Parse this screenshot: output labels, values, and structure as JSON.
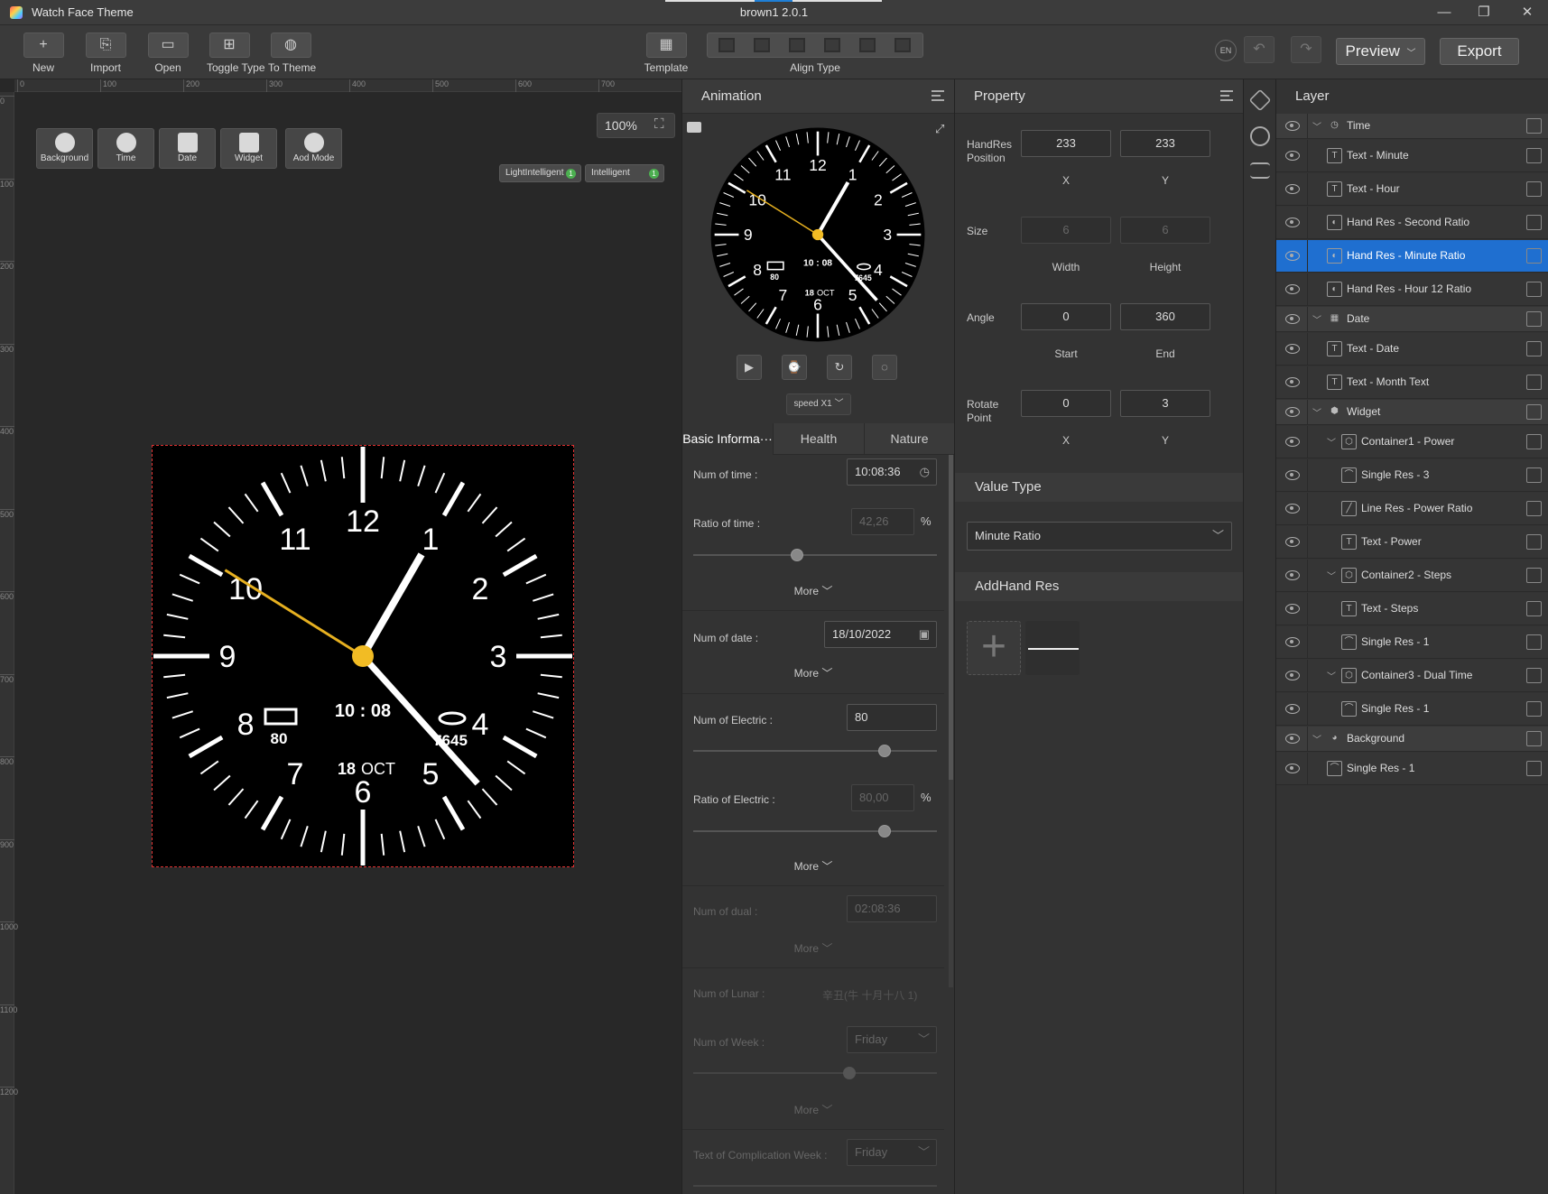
{
  "window": {
    "app_title": "Watch Face Theme",
    "doc_title": "brown1 2.0.1",
    "min": "—",
    "restore": "❐",
    "close": "✕"
  },
  "toolbar": {
    "new": "New",
    "import": "Import",
    "open": "Open",
    "toggle_type": "Toggle Type",
    "to_theme": "To Theme",
    "template": "Template",
    "align_type": "Align Type",
    "lang": "EN",
    "preview": "Preview",
    "export": "Export"
  },
  "canvas": {
    "zoom": "100%",
    "ruler_h": [
      "0",
      "100",
      "200",
      "300",
      "400",
      "500",
      "600",
      "700"
    ],
    "ruler_v": [
      "0",
      "100",
      "200",
      "300",
      "400",
      "500",
      "600",
      "700",
      "800",
      "900",
      "1000",
      "1100",
      "1200"
    ],
    "insert_buttons": [
      "Background",
      "Time",
      "Date",
      "Widget",
      "Aod Mode"
    ],
    "pills": [
      {
        "label": "LightIntelligent",
        "badge": "1"
      },
      {
        "label": "Intelligent",
        "badge": "1"
      }
    ]
  },
  "watch": {
    "numerals": [
      "12",
      "1",
      "2",
      "3",
      "4",
      "5",
      "6",
      "7",
      "8",
      "9",
      "10",
      "11"
    ],
    "digital_time": "10 : 08",
    "battery": "80",
    "steps": "7645",
    "date_day": "18",
    "date_month": "OCT",
    "hour_angle": 30,
    "minute_angle": 138,
    "second_angle": 302,
    "second_hand_color": "#e6b020",
    "center_color": "#f2bc24"
  },
  "animation": {
    "title": "Animation",
    "speed": "speed X1",
    "tabs": [
      "Basic Informa···",
      "Health",
      "Nature"
    ],
    "fields": {
      "num_of_time_label": "Num of time :",
      "num_of_time": "10:08:36",
      "ratio_of_time_label": "Ratio of time :",
      "ratio_of_time": "42,26",
      "pct": "%",
      "ratio_of_time_value": 0.42,
      "more": "More",
      "num_of_date_label": "Num of date :",
      "num_of_date": "18/10/2022",
      "num_of_electric_label": "Num of Electric :",
      "num_of_electric": "80",
      "num_of_electric_value": 0.8,
      "ratio_of_electric_label": "Ratio of Electric :",
      "ratio_of_electric": "80,00",
      "ratio_of_electric_value": 0.8,
      "num_of_dual_label": "Num of dual :",
      "num_of_dual": "02:08:36",
      "num_of_lunar_label": "Num of Lunar :",
      "num_of_lunar": "辛丑(牛 十月十八 1)",
      "num_of_week_label": "Num of Week :",
      "num_of_week": "Friday",
      "num_of_week_value": 0.65,
      "text_comp_week_label": "Text of Complication Week :",
      "text_comp_week": "Friday"
    }
  },
  "property": {
    "title": "Property",
    "handres_position_label": "HandRes Position",
    "pos_x": "233",
    "pos_y": "233",
    "x_label": "X",
    "y_label": "Y",
    "size_label": "Size",
    "width": "6",
    "height": "6",
    "width_label": "Width",
    "height_label": "Height",
    "angle_label": "Angle",
    "angle_start": "0",
    "angle_end": "360",
    "start_label": "Start",
    "end_label": "End",
    "rotate_label": "Rotate Point",
    "rotate_x": "0",
    "rotate_y": "3",
    "value_type_title": "Value Type",
    "value_type": "Minute Ratio",
    "addhand_title": "AddHand Res"
  },
  "layers": {
    "title": "Layer",
    "items": [
      {
        "name": "Time",
        "level": 0,
        "group": true,
        "icon": "clock-icon"
      },
      {
        "name": "Text - Minute",
        "level": 1,
        "icon": "text-icon"
      },
      {
        "name": "Text - Hour",
        "level": 1,
        "icon": "text-icon"
      },
      {
        "name": "Hand Res - Second Ratio",
        "level": 1,
        "icon": "hand-icon"
      },
      {
        "name": "Hand Res - Minute Ratio",
        "level": 1,
        "icon": "hand-icon",
        "selected": true
      },
      {
        "name": "Hand Res - Hour 12 Ratio",
        "level": 1,
        "icon": "hand-icon"
      },
      {
        "name": "Date",
        "level": 0,
        "group": true,
        "icon": "calendar-icon"
      },
      {
        "name": "Text - Date",
        "level": 1,
        "icon": "text-icon"
      },
      {
        "name": "Text - Month Text",
        "level": 1,
        "icon": "text-icon"
      },
      {
        "name": "Widget",
        "level": 0,
        "group": true,
        "icon": "widget-icon"
      },
      {
        "name": "Container1 - Power",
        "level": 1,
        "icon": "container-icon",
        "sub": true
      },
      {
        "name": "Single Res - 3",
        "level": 2,
        "icon": "image-icon"
      },
      {
        "name": "Line Res - Power Ratio",
        "level": 2,
        "icon": "line-icon"
      },
      {
        "name": "Text - Power",
        "level": 2,
        "icon": "text-icon"
      },
      {
        "name": "Container2 - Steps",
        "level": 1,
        "icon": "container-icon",
        "sub": true
      },
      {
        "name": "Text - Steps",
        "level": 2,
        "icon": "text-icon"
      },
      {
        "name": "Single Res - 1",
        "level": 2,
        "icon": "image-icon"
      },
      {
        "name": "Container3 - Dual Time",
        "level": 1,
        "icon": "container-icon",
        "sub": true
      },
      {
        "name": "Single Res - 1",
        "level": 2,
        "icon": "image-icon"
      },
      {
        "name": "Background",
        "level": 0,
        "group": true,
        "icon": "background-icon"
      },
      {
        "name": "Single Res - 1",
        "level": 1,
        "icon": "image-icon"
      }
    ]
  }
}
